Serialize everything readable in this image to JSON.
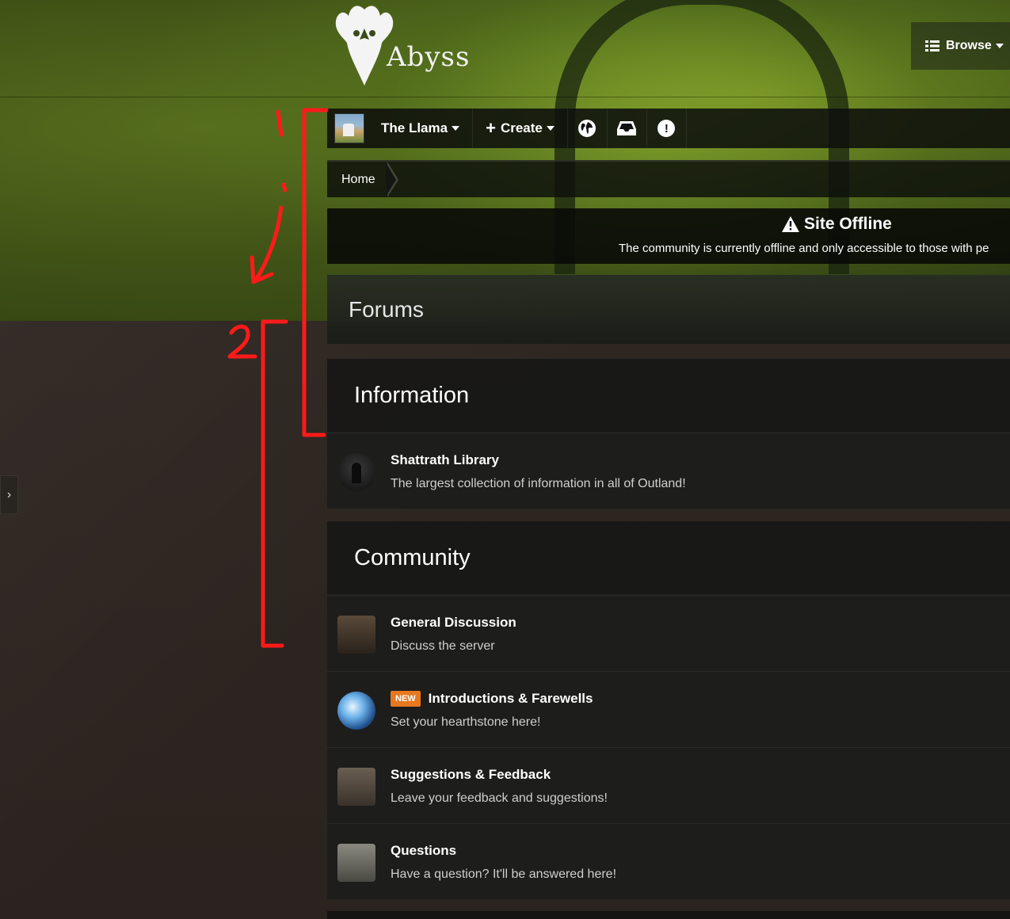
{
  "site": {
    "logo_text": "Abyss"
  },
  "header": {
    "browse_label": "Browse"
  },
  "user_nav": {
    "username": "The Llama",
    "create_label": "Create",
    "icons": [
      "globe-icon",
      "inbox-icon",
      "alert-icon"
    ]
  },
  "breadcrumb": {
    "home": "Home"
  },
  "notice": {
    "title": "Site Offline",
    "message": "The community is currently offline and only accessible to those with pe"
  },
  "forums": {
    "title": "Forums"
  },
  "categories": [
    {
      "title": "Information",
      "forums": [
        {
          "name": "Shattrath Library",
          "description": "The largest collection of information in all of Outland!",
          "icon": "library-icon",
          "badge": ""
        }
      ]
    },
    {
      "title": "Community",
      "forums": [
        {
          "name": "General Discussion",
          "description": "Discuss the server",
          "icon": "keg-icon",
          "badge": ""
        },
        {
          "name": "Introductions & Farewells",
          "description": "Set your hearthstone here!",
          "icon": "hearthstone-icon",
          "badge": "NEW"
        },
        {
          "name": "Suggestions & Feedback",
          "description": "Leave your feedback and suggestions!",
          "icon": "thumbs-up-icon",
          "badge": ""
        },
        {
          "name": "Questions",
          "description": "Have a question? It'll be answered here!",
          "icon": "scroll-icon",
          "badge": ""
        }
      ]
    }
  ],
  "annotations": {
    "label_1": "1",
    "label_2": "2",
    "color": "#ff1a1a"
  },
  "colors": {
    "badge": "#e87820",
    "accent_green": "#6f8a22"
  }
}
